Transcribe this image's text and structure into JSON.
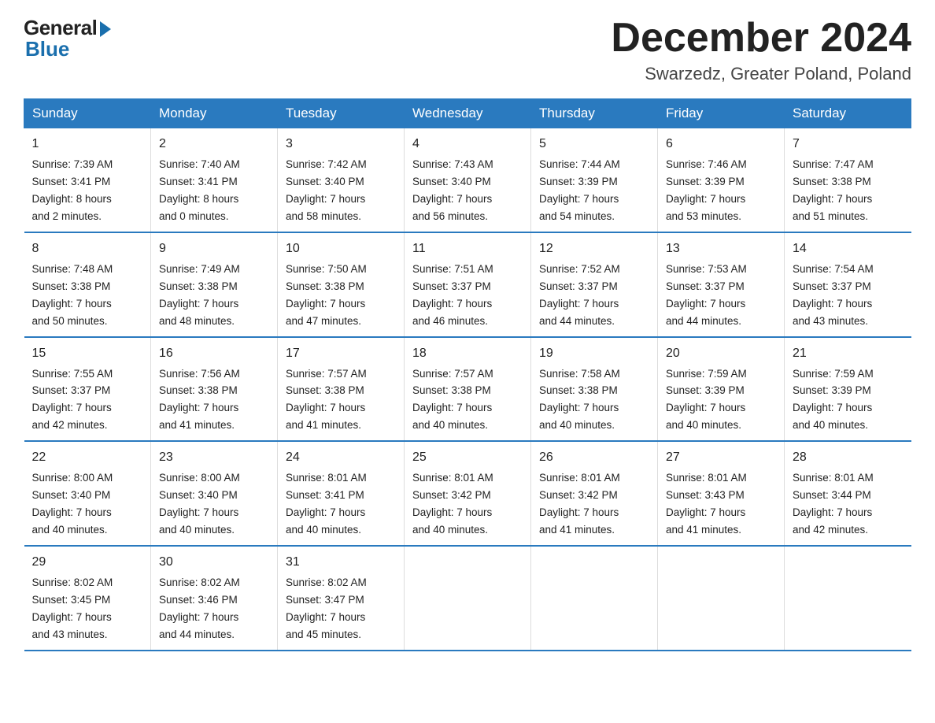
{
  "logo": {
    "general": "General",
    "blue": "Blue"
  },
  "header": {
    "title": "December 2024",
    "subtitle": "Swarzedz, Greater Poland, Poland"
  },
  "columns": [
    "Sunday",
    "Monday",
    "Tuesday",
    "Wednesday",
    "Thursday",
    "Friday",
    "Saturday"
  ],
  "weeks": [
    [
      {
        "day": "1",
        "sunrise": "7:39 AM",
        "sunset": "3:41 PM",
        "daylight": "8 hours and 2 minutes."
      },
      {
        "day": "2",
        "sunrise": "7:40 AM",
        "sunset": "3:41 PM",
        "daylight": "8 hours and 0 minutes."
      },
      {
        "day": "3",
        "sunrise": "7:42 AM",
        "sunset": "3:40 PM",
        "daylight": "7 hours and 58 minutes."
      },
      {
        "day": "4",
        "sunrise": "7:43 AM",
        "sunset": "3:40 PM",
        "daylight": "7 hours and 56 minutes."
      },
      {
        "day": "5",
        "sunrise": "7:44 AM",
        "sunset": "3:39 PM",
        "daylight": "7 hours and 54 minutes."
      },
      {
        "day": "6",
        "sunrise": "7:46 AM",
        "sunset": "3:39 PM",
        "daylight": "7 hours and 53 minutes."
      },
      {
        "day": "7",
        "sunrise": "7:47 AM",
        "sunset": "3:38 PM",
        "daylight": "7 hours and 51 minutes."
      }
    ],
    [
      {
        "day": "8",
        "sunrise": "7:48 AM",
        "sunset": "3:38 PM",
        "daylight": "7 hours and 50 minutes."
      },
      {
        "day": "9",
        "sunrise": "7:49 AM",
        "sunset": "3:38 PM",
        "daylight": "7 hours and 48 minutes."
      },
      {
        "day": "10",
        "sunrise": "7:50 AM",
        "sunset": "3:38 PM",
        "daylight": "7 hours and 47 minutes."
      },
      {
        "day": "11",
        "sunrise": "7:51 AM",
        "sunset": "3:37 PM",
        "daylight": "7 hours and 46 minutes."
      },
      {
        "day": "12",
        "sunrise": "7:52 AM",
        "sunset": "3:37 PM",
        "daylight": "7 hours and 44 minutes."
      },
      {
        "day": "13",
        "sunrise": "7:53 AM",
        "sunset": "3:37 PM",
        "daylight": "7 hours and 44 minutes."
      },
      {
        "day": "14",
        "sunrise": "7:54 AM",
        "sunset": "3:37 PM",
        "daylight": "7 hours and 43 minutes."
      }
    ],
    [
      {
        "day": "15",
        "sunrise": "7:55 AM",
        "sunset": "3:37 PM",
        "daylight": "7 hours and 42 minutes."
      },
      {
        "day": "16",
        "sunrise": "7:56 AM",
        "sunset": "3:38 PM",
        "daylight": "7 hours and 41 minutes."
      },
      {
        "day": "17",
        "sunrise": "7:57 AM",
        "sunset": "3:38 PM",
        "daylight": "7 hours and 41 minutes."
      },
      {
        "day": "18",
        "sunrise": "7:57 AM",
        "sunset": "3:38 PM",
        "daylight": "7 hours and 40 minutes."
      },
      {
        "day": "19",
        "sunrise": "7:58 AM",
        "sunset": "3:38 PM",
        "daylight": "7 hours and 40 minutes."
      },
      {
        "day": "20",
        "sunrise": "7:59 AM",
        "sunset": "3:39 PM",
        "daylight": "7 hours and 40 minutes."
      },
      {
        "day": "21",
        "sunrise": "7:59 AM",
        "sunset": "3:39 PM",
        "daylight": "7 hours and 40 minutes."
      }
    ],
    [
      {
        "day": "22",
        "sunrise": "8:00 AM",
        "sunset": "3:40 PM",
        "daylight": "7 hours and 40 minutes."
      },
      {
        "day": "23",
        "sunrise": "8:00 AM",
        "sunset": "3:40 PM",
        "daylight": "7 hours and 40 minutes."
      },
      {
        "day": "24",
        "sunrise": "8:01 AM",
        "sunset": "3:41 PM",
        "daylight": "7 hours and 40 minutes."
      },
      {
        "day": "25",
        "sunrise": "8:01 AM",
        "sunset": "3:42 PM",
        "daylight": "7 hours and 40 minutes."
      },
      {
        "day": "26",
        "sunrise": "8:01 AM",
        "sunset": "3:42 PM",
        "daylight": "7 hours and 41 minutes."
      },
      {
        "day": "27",
        "sunrise": "8:01 AM",
        "sunset": "3:43 PM",
        "daylight": "7 hours and 41 minutes."
      },
      {
        "day": "28",
        "sunrise": "8:01 AM",
        "sunset": "3:44 PM",
        "daylight": "7 hours and 42 minutes."
      }
    ],
    [
      {
        "day": "29",
        "sunrise": "8:02 AM",
        "sunset": "3:45 PM",
        "daylight": "7 hours and 43 minutes."
      },
      {
        "day": "30",
        "sunrise": "8:02 AM",
        "sunset": "3:46 PM",
        "daylight": "7 hours and 44 minutes."
      },
      {
        "day": "31",
        "sunrise": "8:02 AM",
        "sunset": "3:47 PM",
        "daylight": "7 hours and 45 minutes."
      },
      null,
      null,
      null,
      null
    ]
  ],
  "labels": {
    "sunrise": "Sunrise:",
    "sunset": "Sunset:",
    "daylight": "Daylight:"
  }
}
